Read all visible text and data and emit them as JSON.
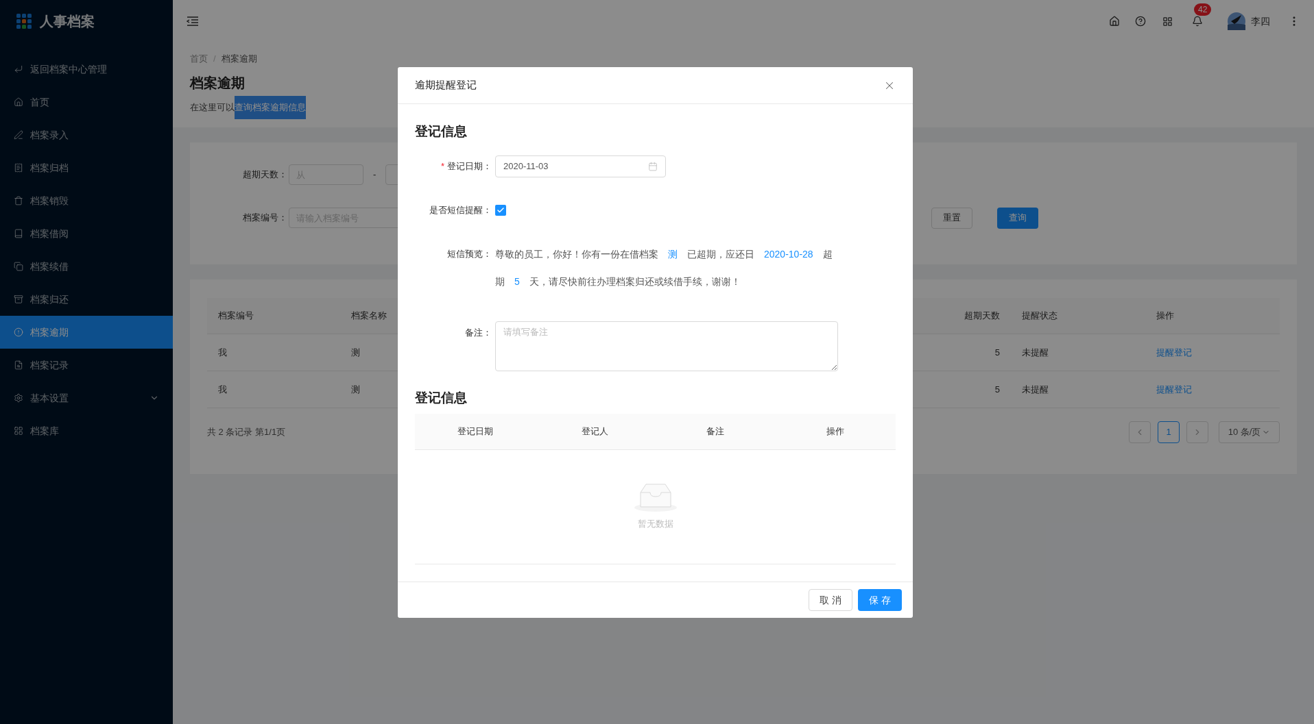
{
  "app": {
    "title": "人事档案"
  },
  "sidebar": {
    "items": [
      {
        "label": "返回档案中心管理",
        "selected": false,
        "submenu": false
      },
      {
        "label": "首页",
        "selected": false,
        "submenu": false
      },
      {
        "label": "档案录入",
        "selected": false,
        "submenu": false
      },
      {
        "label": "档案归档",
        "selected": false,
        "submenu": false
      },
      {
        "label": "档案销毁",
        "selected": false,
        "submenu": false
      },
      {
        "label": "档案借阅",
        "selected": false,
        "submenu": false
      },
      {
        "label": "档案续借",
        "selected": false,
        "submenu": false
      },
      {
        "label": "档案归还",
        "selected": false,
        "submenu": false
      },
      {
        "label": "档案逾期",
        "selected": true,
        "submenu": false
      },
      {
        "label": "档案记录",
        "selected": false,
        "submenu": false
      },
      {
        "label": "基本设置",
        "selected": false,
        "submenu": true
      },
      {
        "label": "档案库",
        "selected": false,
        "submenu": false
      }
    ]
  },
  "header": {
    "notification_count": "42",
    "user": "李四"
  },
  "breadcrumb": {
    "items": [
      "首页",
      "档案逾期"
    ],
    "separator": "/"
  },
  "page": {
    "title": "档案逾期",
    "description": {
      "text": "在这里可以",
      "selected_text": "查询档案逾期信息"
    }
  },
  "filters": {
    "overdue_days": {
      "label": "超期天数：",
      "from_placeholder": "从",
      "separator": "-"
    },
    "file_number": {
      "label": "档案编号：",
      "placeholder": "请输入档案编号"
    },
    "buttons": [
      "重置",
      "查询"
    ]
  },
  "table": {
    "columns": [
      "档案编号",
      "档案名称",
      "超期天数",
      "提醒状态",
      "操作"
    ],
    "rows": [
      [
        "我",
        "测",
        "5",
        "未提醒",
        "提醒登记"
      ],
      [
        "我",
        "测",
        "5",
        "未提醒",
        "提醒登记"
      ]
    ]
  },
  "pagination": {
    "summary": "共 2 条记录 第1/1页",
    "pages": [
      {
        "label": "1",
        "selected": true
      }
    ],
    "page_size": "10 条/页"
  },
  "modal": {
    "title": "逾期提醒登记",
    "section_title": "登记信息",
    "date": {
      "label": "登记日期：",
      "required_mark": "*",
      "value": "2020-11-03"
    },
    "sms": {
      "label": "是否短信提醒：",
      "checked": true
    },
    "preview": {
      "label": "短信预览：",
      "segments": [
        {
          "text": "尊敬的员工，你好！你有一份在借档案",
          "kind": "plain"
        },
        {
          "text": "测",
          "kind": "value"
        },
        {
          "text": "已超期，应还日",
          "kind": "plain"
        },
        {
          "text": "2020-10-28",
          "kind": "value"
        },
        {
          "text": "超期",
          "kind": "plain"
        },
        {
          "text": "5",
          "kind": "value"
        },
        {
          "text": "天，请尽快前往办理档案归还或续借手续，谢谢！",
          "kind": "plain"
        }
      ]
    },
    "remark": {
      "label": "备注：",
      "placeholder": "请填写备注"
    },
    "records_title": "登记信息",
    "records_columns": [
      "登记日期",
      "登记人",
      "备注",
      "操作"
    ],
    "empty_text": "暂无数据",
    "buttons": [
      {
        "label": "取 消",
        "kind": "default"
      },
      {
        "label": "保 存",
        "kind": "primary"
      }
    ]
  }
}
